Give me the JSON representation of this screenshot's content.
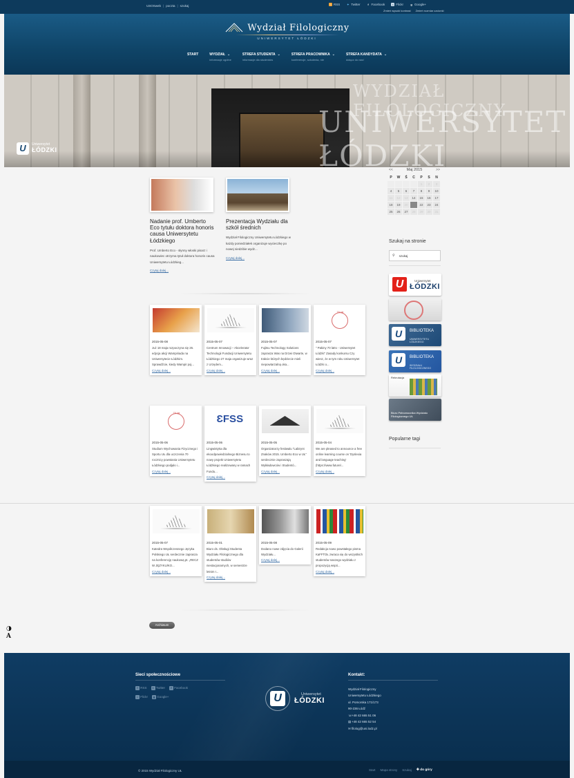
{
  "topbar": {
    "links": [
      "USOSweb",
      "poczta",
      "szukaj"
    ],
    "social": [
      {
        "label": "RSS",
        "icon": "rss-icon"
      },
      {
        "label": "Twitter",
        "icon": "twitter-icon"
      },
      {
        "label": "Facebook",
        "icon": "facebook-icon"
      },
      {
        "label": "Flickr",
        "icon": "flickr-icon"
      },
      {
        "label": "Google+",
        "icon": "googleplus-icon"
      }
    ],
    "contrast_label": "Zmień wysoki kontrast",
    "font_size_label": "Zmień rozmiar czcionki"
  },
  "header": {
    "title": "Wydział Filologiczny",
    "subtitle": "UNIWERSYTET ŁÓDZKI",
    "nav": [
      {
        "label": "START",
        "sub": "",
        "dropdown": false
      },
      {
        "label": "WYDZIAŁ",
        "sub": "informacje ogólne",
        "dropdown": true
      },
      {
        "label": "STREFA STUDENTA",
        "sub": "informacje dla studentów",
        "dropdown": true
      },
      {
        "label": "STREFA PRACOWNIKA",
        "sub": "konferencje, szkolenia, nie",
        "dropdown": true
      },
      {
        "label": "STREFA KANDYDATA",
        "sub": "dołącz do nas!",
        "dropdown": true
      }
    ]
  },
  "hero": {
    "wall_text_1": "WYDZIAŁ FILOLOGICZNY",
    "wall_text_2": "UNIWERSYTET ŁÓDZKI",
    "logo_line1": "Uniwersytet",
    "logo_line2": "ŁÓDZKI"
  },
  "featured": [
    {
      "title": "Nadanie prof. Umberto Eco tytułu doktora honoris causa Uniwersytetu Łódzkiego",
      "excerpt": "Prof. Umberto Eco - słynny włoski pisarz i naukowiec otrzyma tytuł doktora honoris causa Uniwersytetu Łódzkieg...",
      "more": "Czytaj dalej..."
    },
    {
      "title": "Prezentacja Wydziału dla szkół średnich",
      "excerpt": "Wydział Filologiczny Uniwersytetu Łódzkiego w każdy poniedziałek organizuje wycieczkę po nowej siedzibie wydz...",
      "more": "Czytaj dalej..."
    }
  ],
  "cards": [
    {
      "date": "2015-05-08",
      "text": "Już 18 maja rozpoczyna się 26. edycja akcji Wampiriada na Uniwersytecie Łódzkim. Sprawdźcie, kiedy Wampir poj...",
      "more": "Czytaj dalej...",
      "thumb": "wampiriada"
    },
    {
      "date": "2015-05-07",
      "text": "Centrum Innowacji – Akcelerator Technologii Fundacji Uniwersytetu Łódzkiego 27 maja organizuje wraz z Urzędem...",
      "more": "Czytaj dalej...",
      "thumb": "book"
    },
    {
      "date": "2015-05-07",
      "text": "Fujitsu Technology Solutions zaprasza Was na Drzwi Otwarte, w trakcie których będziecie mieli niepowtarzalną oka...",
      "more": "Czytaj dalej...",
      "thumb": "fujitsu"
    },
    {
      "date": "2015-05-07",
      "text": "\" Pakiny 70 lat!o - Uniwersytet Łódzki\" Zasady konkursu Czy wiesz, że w tym roku Uniwersytet Łódzki o...",
      "more": "Czytaj dalej...",
      "thumb": "70"
    },
    {
      "date": "2015-05-06",
      "text": "Studium Wychowania Fizycznego i Sportu UŁ dla uczczenia 70 rocznicy powstania Uniwersytetu Łódzkiego podjęło i...",
      "more": "Czytaj dalej...",
      "thumb": "70"
    },
    {
      "date": "2015-05-06",
      "text": "Lingwistyka dla ekoodpowiedzialnego Biznesu to nowy projekt Uniwersytetu Łódzkiego realizowany w ramach Fundu...",
      "more": "Czytaj dalej...",
      "thumb": "fss"
    },
    {
      "date": "2015-05-05",
      "text": "Organizatorzy festiwalu \"Labirynt Znaków 2015. Umberto Eco w UŁ\" serdecznie zapraszają Wykładowców i Studentó...",
      "more": "Czytaj dalej...",
      "thumb": "book-dark"
    },
    {
      "date": "2015-05-04",
      "text": "We are pleased to announce a free online learning course on 'Dyslexia and language teaching' (https://www.futurel...",
      "more": "Czytaj dalej...",
      "thumb": "book"
    },
    {
      "date": "2015-05-07",
      "text": "Katedra Współczesnego Języka Polskiego UŁ serdecznie zaprasza na konferencję naukową pt. „RECZ W JĘZYKU/KO...",
      "more": "Czytaj dalej...",
      "thumb": "book"
    },
    {
      "date": "2015-05-01",
      "text": "Biuro ds. Obsługi Studenta Wydziału Filologicznego dla studentów studiów niestacjonarnych, w semestrze letnim r...",
      "more": "Czytaj dalej...",
      "thumb": "office"
    },
    {
      "date": "2015-05-08",
      "text": "Dodano nowe zdjęcia do Galerii Wydziału...",
      "more": "Czytaj dalej...",
      "thumb": "gallery"
    },
    {
      "date": "2015-05-09",
      "text": "Redakcja nowo powstałego pisma KaFFTOŁ zwraca się do wszystkich studentów naszego wydziału z propozycją wspó...",
      "more": "Czytaj dalej...",
      "thumb": "flags"
    }
  ],
  "older_button": "Archiwum",
  "calendar": {
    "prev": "<<",
    "month": "Maj 2015",
    "next": ">>",
    "days": [
      "P",
      "W",
      "Ś",
      "C",
      "P",
      "S",
      "N"
    ],
    "rows": [
      [
        "",
        "",
        "",
        "",
        "1",
        "2",
        "3"
      ],
      [
        "4",
        "5",
        "6",
        "7",
        "8",
        "9",
        "10"
      ],
      [
        "11",
        "12",
        "13",
        "14",
        "15",
        "16",
        "17"
      ],
      [
        "18",
        "19",
        "20",
        "21",
        "22",
        "23",
        "24"
      ],
      [
        "25",
        "26",
        "27",
        "28",
        "29",
        "30",
        "31"
      ]
    ],
    "selected": "21"
  },
  "sidebar": {
    "search_title": "Szukaj na stronie",
    "search_placeholder": "szukaj",
    "banner1_line1": "Uniwersytet",
    "banner1_line2": "ŁÓDZKI",
    "banner3_line1": "BIBLIOTEKA",
    "banner3_line2": "UNIWERSYTETU ŁÓDZKIEGO",
    "banner4_line1": "BIBLIOTEKA",
    "banner4_line2": "WYDZIAŁU FILOLOGICZNEGO",
    "banner5_label": "Rekrutacja",
    "banner6_label": "Biuro Pełnomocnika Wydziału Filologicznego UŁ",
    "tags_title": "Popularne tagi"
  },
  "accessibility": {
    "contrast": "◑",
    "font": "A"
  },
  "footer": {
    "social_title": "Sieci społecznościowe",
    "social": [
      {
        "label": "RSS",
        "icon": "rss-icon"
      },
      {
        "label": "Twitter",
        "icon": "twitter-icon"
      },
      {
        "label": "Facebook",
        "icon": "facebook-icon"
      },
      {
        "label": "Flickr",
        "icon": "flickr-icon"
      },
      {
        "label": "Google+",
        "icon": "googleplus-icon"
      }
    ],
    "logo_line1": "Uniwersytet",
    "logo_line2": "ŁÓDZKI",
    "contact_title": "Kontakt:",
    "contact": [
      "Wydział Filologiczny",
      "Uniwersytetu Łódzkiego",
      "ul. Pomorska 171/173",
      "90-236 Łódź"
    ],
    "phone": "+48 42 665 51 06",
    "fax": "+48 42 665 52 54",
    "email": "filolog@uni.lodz.pl",
    "copyright": "© 2015 Wydział Filologiczny UŁ",
    "bottom_links": [
      "Start",
      "Mapa strony",
      "Szukaj"
    ],
    "up_label": "do góry"
  },
  "colors": {
    "header": "#0f4467",
    "link": "#3a6ea5",
    "red": "#e32119",
    "footer": "#0f3c63"
  }
}
